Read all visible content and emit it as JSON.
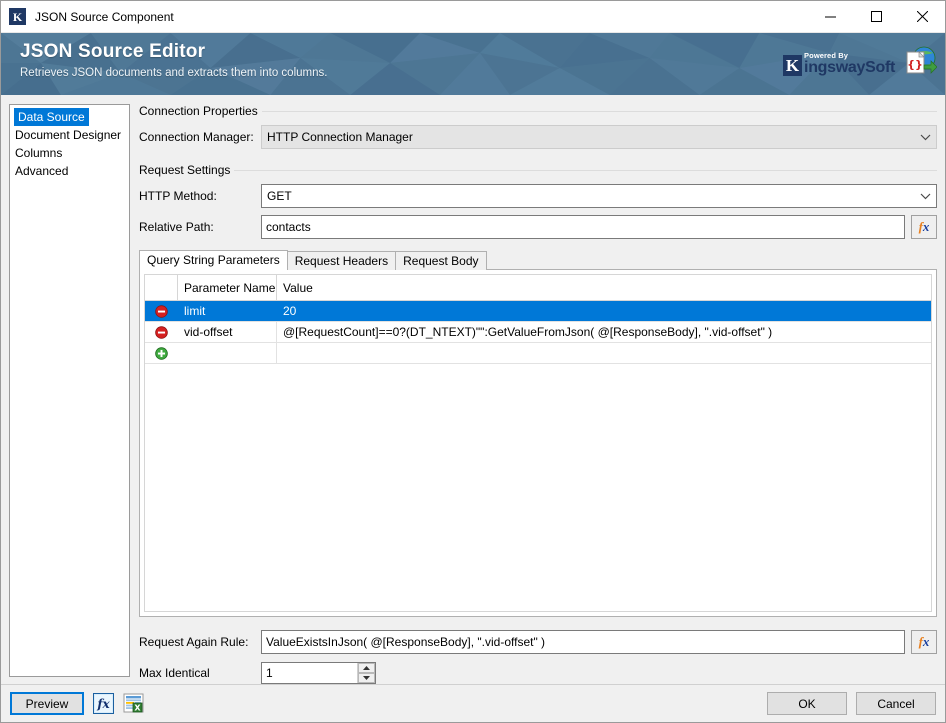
{
  "window": {
    "title": "JSON Source Component",
    "app_icon": "kingswaysoft-k-icon",
    "controls": {
      "minimize": "minimize-icon",
      "maximize": "maximize-icon",
      "close": "close-icon"
    }
  },
  "banner": {
    "title": "JSON Source Editor",
    "subtitle": "Retrieves JSON documents and extracts them into columns.",
    "brand": {
      "powered_by": "Powered By",
      "name_first": "ingsway",
      "name_second": "Soft",
      "letter": "K",
      "icon": "json-globe-icon"
    },
    "bg_color": "#4d7694"
  },
  "sidebar": {
    "items": [
      {
        "label": "Data Source",
        "selected": true
      },
      {
        "label": "Document Designer",
        "selected": false
      },
      {
        "label": "Columns",
        "selected": false
      },
      {
        "label": "Advanced",
        "selected": false
      }
    ],
    "selected_color": "#0078d7"
  },
  "connection_properties": {
    "group_label": "Connection Properties",
    "connection_manager": {
      "label": "Connection Manager:",
      "value": "HTTP Connection Manager",
      "disabled": true
    }
  },
  "request_settings": {
    "group_label": "Request Settings",
    "http_method": {
      "label": "HTTP Method:",
      "value": "GET"
    },
    "relative_path": {
      "label": "Relative Path:",
      "value": "contacts",
      "placeholder": ""
    },
    "fx_button_label": "fx"
  },
  "tabs": [
    {
      "label": "Query String Parameters",
      "active": true
    },
    {
      "label": "Request Headers",
      "active": false
    },
    {
      "label": "Request Body",
      "active": false
    }
  ],
  "grid": {
    "columns": [
      "",
      "Parameter Name",
      "Value"
    ],
    "rows": [
      {
        "action": "remove-row-icon",
        "parameter_name": "limit",
        "value": "20",
        "selected": true
      },
      {
        "action": "remove-row-icon",
        "parameter_name": "vid-offset",
        "value": "@[RequestCount]==0?(DT_NTEXT)\"\":GetValueFromJson( @[ResponseBody], \".vid-offset\" )",
        "selected": false
      },
      {
        "action": "add-row-icon",
        "parameter_name": "",
        "value": "",
        "selected": false
      }
    ],
    "selection_color": "#0078d7"
  },
  "footer_fields": {
    "request_again_rule": {
      "label": "Request Again Rule:",
      "value": "ValueExistsInJson( @[ResponseBody], \".vid-offset\" )"
    },
    "max_identical": {
      "label": "Max Identical",
      "value": "1"
    }
  },
  "footer": {
    "preview_label": "Preview",
    "expression_icon": "fx-icon",
    "report_icon": "export-report-icon",
    "ok_label": "OK",
    "cancel_label": "Cancel"
  }
}
